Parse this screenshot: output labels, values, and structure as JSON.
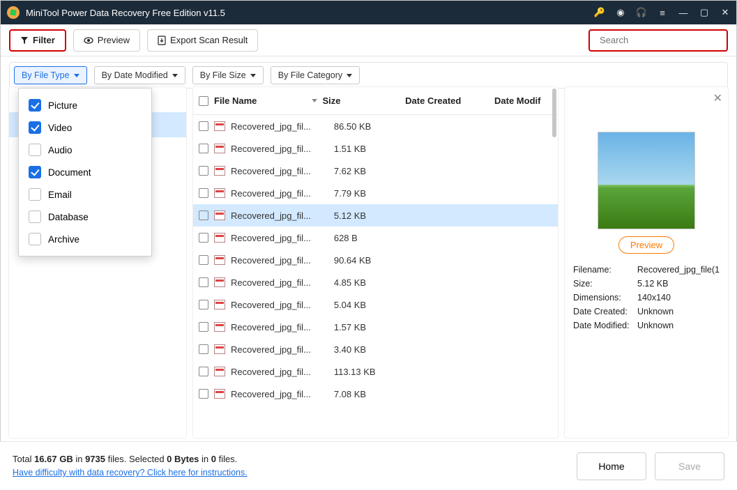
{
  "app_title": "MiniTool Power Data Recovery Free Edition v11.5",
  "toolbar": {
    "filter": "Filter",
    "preview": "Preview",
    "export": "Export Scan Result",
    "search_placeholder": "Search"
  },
  "filter_chips": {
    "by_type": "By File Type",
    "by_date": "By Date Modified",
    "by_size": "By File Size",
    "by_category": "By File Category"
  },
  "type_filter_options": [
    {
      "label": "Picture",
      "checked": true
    },
    {
      "label": "Video",
      "checked": true
    },
    {
      "label": "Audio",
      "checked": false
    },
    {
      "label": "Document",
      "checked": true
    },
    {
      "label": "Email",
      "checked": false
    },
    {
      "label": "Database",
      "checked": false
    },
    {
      "label": "Archive",
      "checked": false
    }
  ],
  "columns": {
    "name": "File Name",
    "size": "Size",
    "created": "Date Created",
    "modified": "Date Modif"
  },
  "files": [
    {
      "name": "Recovered_jpg_fil...",
      "size": "86.50 KB",
      "selected": false
    },
    {
      "name": "Recovered_jpg_fil...",
      "size": "1.51 KB",
      "selected": false
    },
    {
      "name": "Recovered_jpg_fil...",
      "size": "7.62 KB",
      "selected": false
    },
    {
      "name": "Recovered_jpg_fil...",
      "size": "7.79 KB",
      "selected": false
    },
    {
      "name": "Recovered_jpg_fil...",
      "size": "5.12 KB",
      "selected": true
    },
    {
      "name": "Recovered_jpg_fil...",
      "size": "628 B",
      "selected": false
    },
    {
      "name": "Recovered_jpg_fil...",
      "size": "90.64 KB",
      "selected": false
    },
    {
      "name": "Recovered_jpg_fil...",
      "size": "4.85 KB",
      "selected": false
    },
    {
      "name": "Recovered_jpg_fil...",
      "size": "5.04 KB",
      "selected": false
    },
    {
      "name": "Recovered_jpg_fil...",
      "size": "1.57 KB",
      "selected": false
    },
    {
      "name": "Recovered_jpg_fil...",
      "size": "3.40 KB",
      "selected": false
    },
    {
      "name": "Recovered_jpg_fil...",
      "size": "113.13 KB",
      "selected": false
    },
    {
      "name": "Recovered_jpg_fil...",
      "size": "7.08 KB",
      "selected": false
    }
  ],
  "preview_panel": {
    "button": "Preview",
    "filename_k": "Filename:",
    "filename_v": "Recovered_jpg_file(1",
    "size_k": "Size:",
    "size_v": "5.12 KB",
    "dim_k": "Dimensions:",
    "dim_v": "140x140",
    "created_k": "Date Created:",
    "created_v": "Unknown",
    "modified_k": "Date Modified:",
    "modified_v": "Unknown"
  },
  "status": {
    "line1_a": "Total ",
    "line1_b": "16.67 GB",
    "line1_c": " in ",
    "line1_d": "9735",
    "line1_e": " files.   Selected ",
    "line1_f": "0 Bytes",
    "line1_g": " in ",
    "line1_h": "0",
    "line1_i": " files.",
    "help_link": "Have difficulty with data recovery? Click here for instructions."
  },
  "buttons": {
    "home": "Home",
    "save": "Save"
  }
}
